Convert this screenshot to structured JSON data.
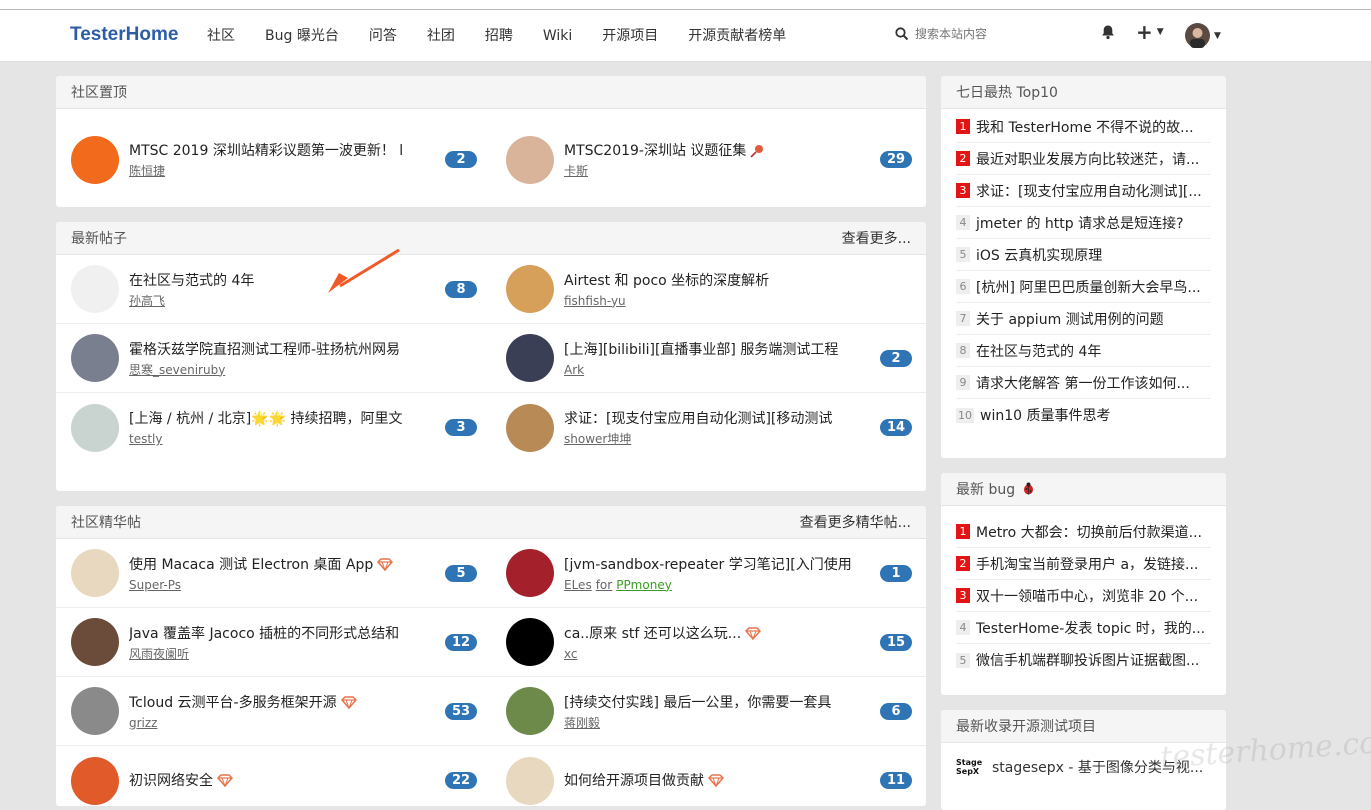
{
  "brand": "TesterHome",
  "nav": [
    "社区",
    "Bug 曝光台",
    "问答",
    "社团",
    "招聘",
    "Wiki",
    "开源项目",
    "开源贡献者榜单"
  ],
  "search": {
    "placeholder": "搜索本站内容",
    "icon": "search-icon"
  },
  "pinned": {
    "title": "社区置顶",
    "topics": [
      {
        "title": "MTSC 2019 深圳站精彩议题第一波更新！ l",
        "author": "陈恒捷",
        "replies": "2",
        "avatar_color": "#f26a1b"
      },
      {
        "title": "MTSC2019-深圳站 议题征集",
        "author": "卡斯",
        "replies": "29",
        "avatar_color": "#d9b49a",
        "pin_icon": "pushpin-icon"
      }
    ]
  },
  "latest": {
    "title": "最新帖子",
    "more": "查看更多...",
    "topics": [
      {
        "title": "在社区与范式的 4年",
        "author": "孙高飞",
        "replies": "8",
        "avatar_color": "#f0f0f0"
      },
      {
        "title": "Airtest 和 poco 坐标的深度解析",
        "author": "fishfish-yu",
        "replies": "",
        "avatar_color": "#d6a05a"
      },
      {
        "title": "霍格沃兹学院直招测试工程师-驻扬杭州网易",
        "author": "思寒_seveniruby",
        "replies": "",
        "avatar_color": "#7a7f8f"
      },
      {
        "title": "[上海][bilibili][直播事业部] 服务端测试工程",
        "author": "Ark",
        "replies": "2",
        "avatar_color": "#3a3f55"
      },
      {
        "title": "[上海 / 杭州 / 北京]🌟🌟 持续招聘，阿里文",
        "author": "testly",
        "replies": "3",
        "avatar_color": "#c9d3cf"
      },
      {
        "title": "求证：[现支付宝应用自动化测试][移动测试",
        "author": "shower坤坤",
        "replies": "14",
        "avatar_color": "#b88a55"
      }
    ]
  },
  "featured": {
    "title": "社区精华帖",
    "more": "查看更多精华帖...",
    "topics": [
      {
        "title": "使用 Macaca 测试 Electron 桌面 App",
        "author": "Super-Ps",
        "replies": "5",
        "avatar_color": "#e8d8c0",
        "gem": true
      },
      {
        "title": "[jvm-sandbox-repeater 学习笔记][入门使用",
        "author": "ELes",
        "org_prefix": "for",
        "org": "PPmoney",
        "replies": "1",
        "avatar_color": "#a4212b"
      },
      {
        "title": "Java 覆盖率 Jacoco 插桩的不同形式总结和",
        "author": "风雨夜阑听",
        "replies": "12",
        "avatar_color": "#6b4b3a"
      },
      {
        "title": "ca..原来 stf 还可以这么玩...",
        "author": "xc",
        "replies": "15",
        "avatar_color": "#000000",
        "gem": true
      },
      {
        "title": "Tcloud 云测平台-多服务框架开源",
        "author": "grizz",
        "replies": "53",
        "avatar_color": "#8a8a8a",
        "gem": true
      },
      {
        "title": "[持续交付实践] 最后一公里，你需要一套具",
        "author": "蒋刚毅",
        "replies": "6",
        "avatar_color": "#6d8a4a"
      },
      {
        "title": "初识网络安全",
        "author": "",
        "replies": "22",
        "avatar_color": "#e05a2a",
        "gem": true
      },
      {
        "title": "如何给开源项目做贡献",
        "author": "",
        "replies": "11",
        "avatar_color": "#e8d8c0",
        "gem": true
      }
    ]
  },
  "hot": {
    "title": "七日最热 Top10",
    "items": [
      {
        "n": "1",
        "text": "我和 TesterHome 不得不说的故..."
      },
      {
        "n": "2",
        "text": "最近对职业发展方向比较迷茫，请..."
      },
      {
        "n": "3",
        "text": "求证：[现支付宝应用自动化测试][..."
      },
      {
        "n": "4",
        "text": "jmeter 的 http 请求总是短连接?"
      },
      {
        "n": "5",
        "text": "iOS 云真机实现原理"
      },
      {
        "n": "6",
        "text": "[杭州] 阿里巴巴质量创新大会早鸟..."
      },
      {
        "n": "7",
        "text": "关于 appium 测试用例的问题"
      },
      {
        "n": "8",
        "text": "在社区与范式的 4年"
      },
      {
        "n": "9",
        "text": "请求大佬解答 第一份工作该如何..."
      },
      {
        "n": "10",
        "text": "win10 质量事件思考"
      }
    ]
  },
  "bugs": {
    "title": "最新 bug",
    "icon": "ladybug-icon",
    "items": [
      {
        "n": "1",
        "text": "Metro 大都会：切换前后付款渠道..."
      },
      {
        "n": "2",
        "text": "手机淘宝当前登录用户 a，发链接..."
      },
      {
        "n": "3",
        "text": "双十一领喵币中心，浏览非 20 个..."
      },
      {
        "n": "4",
        "text": "TesterHome-发表 topic 时，我的..."
      },
      {
        "n": "5",
        "text": "微信手机端群聊投诉图片证据截图..."
      }
    ]
  },
  "opensource": {
    "title": "最新收录开源测试项目",
    "items": [
      {
        "logo": "Stage SepX",
        "text": "stagesepx - 基于图像分类与视..."
      }
    ]
  },
  "watermark": "testerhome.com",
  "colors": {
    "brand": "#2e5da8",
    "badge": "#2f74b5",
    "rank_hot": "#e31414",
    "notice_dot": "#ff0000",
    "arrow": "#f05a28",
    "gem": "#e8734a"
  }
}
